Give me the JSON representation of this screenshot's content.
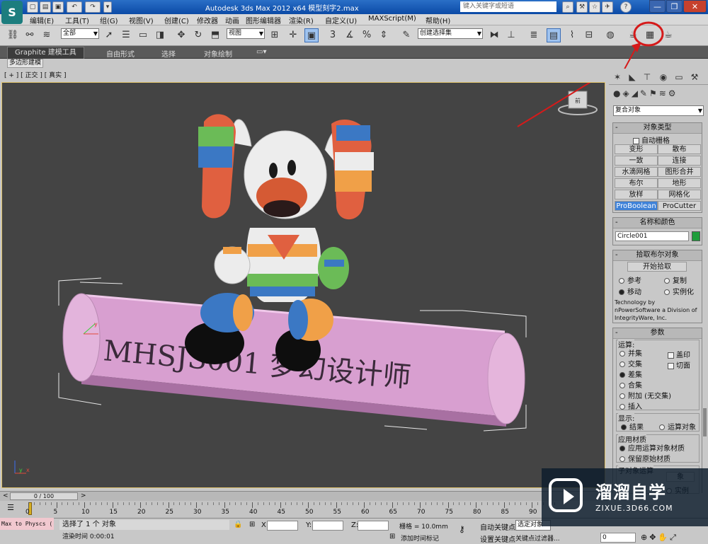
{
  "app": {
    "logo": "S",
    "title": "Autodesk 3ds Max  2012 x64    模型刻字2.max",
    "search_placeholder": "键入关键字或短语"
  },
  "quick_access": [
    "new-icon",
    "open-icon",
    "save-icon",
    "undo-icon",
    "redo-icon",
    "dropdown-icon"
  ],
  "window_controls": {
    "minimize": "—",
    "restore": "❐",
    "close": "✕"
  },
  "menubar": [
    "编辑(E)",
    "工具(T)",
    "组(G)",
    "视图(V)",
    "创建(C)",
    "修改器",
    "动画",
    "图形编辑器",
    "渲染(R)",
    "自定义(U)",
    "MAXScript(M)",
    "帮助(H)"
  ],
  "toolbar": {
    "filter_value": "全部",
    "refcoord_value": "视图",
    "selection_set_value": "创建选择集",
    "snap_label": "3"
  },
  "ribbon": {
    "tabs": [
      "Graphite 建模工具",
      "自由形式",
      "选择",
      "对象绘制"
    ],
    "active_tab": 0,
    "sub_tab": "多边形建模"
  },
  "viewport": {
    "label": "[ + ] [ 正交 ] [ 真实 ]",
    "text_on_cylinder": "MHSJS001 梦幻设计师",
    "gizmo_y": "y",
    "gizmo_x": "x",
    "viewcube": "前"
  },
  "command_panel": {
    "category_value": "复合对象",
    "object_type": {
      "title": "对象类型",
      "autogrid": "自动栅格",
      "buttons": [
        "变形",
        "散布",
        "一致",
        "连接",
        "水滴网格",
        "图形合并",
        "布尔",
        "地形",
        "放样",
        "网格化",
        "ProBoolean",
        "ProCutter"
      ],
      "selected": "ProBoolean"
    },
    "name_color": {
      "title": "名称和颜色",
      "name": "Circle001",
      "color": "#1e9d3a"
    },
    "pick": {
      "title": "拾取布尔对象",
      "start_pick": "开始拾取",
      "opts": [
        "参考",
        "复制",
        "移动",
        "实例化"
      ],
      "selected": "移动"
    },
    "credit": "Technology by nPowerSoftware a Division of IntegrityWare, Inc.",
    "params": {
      "title": "参数",
      "op_label": "运算:",
      "ops": [
        "并集",
        "交集",
        "差集",
        "合集",
        "附加 (无交集)",
        "插入"
      ],
      "selected_op": "差集",
      "checks": [
        "盖印",
        "切面"
      ],
      "display_label": "显示:",
      "display_opts": [
        "结果",
        "运算对象"
      ],
      "display_selected": "结果",
      "mat_label": "应用材质",
      "mat_opts": [
        "应用运算对象材质",
        "保留原始材质"
      ],
      "mat_selected": "应用运算对象材质",
      "sub_label": "子对象运算",
      "sub_btn": "象",
      "sub_opt": "实例"
    }
  },
  "timeline": {
    "frame": "0 / 100",
    "ticks": [
      "0",
      "5",
      "10",
      "15",
      "20",
      "25",
      "30",
      "35",
      "40",
      "45",
      "50",
      "55",
      "60",
      "65",
      "70",
      "75",
      "80",
      "85",
      "90"
    ]
  },
  "status": {
    "maxscript": "Max to Physcs (",
    "selected": "选择了 1 个 对象",
    "render_time": "渲染时间  0:00:01",
    "x_label": "X:",
    "y_label": "Y:",
    "z_label": "Z:",
    "grid": "栅格 = 10.0mm",
    "add_time_tag": "添加时间标记",
    "auto_key": "自动关键点",
    "auto_key_value": "选定对象",
    "set_key": "设置关键点",
    "key_filters": "关键点过滤器...",
    "frame_value": "0"
  },
  "watermark": {
    "title": "溜溜自学",
    "url": "ZIXUE.3D66.COM"
  }
}
